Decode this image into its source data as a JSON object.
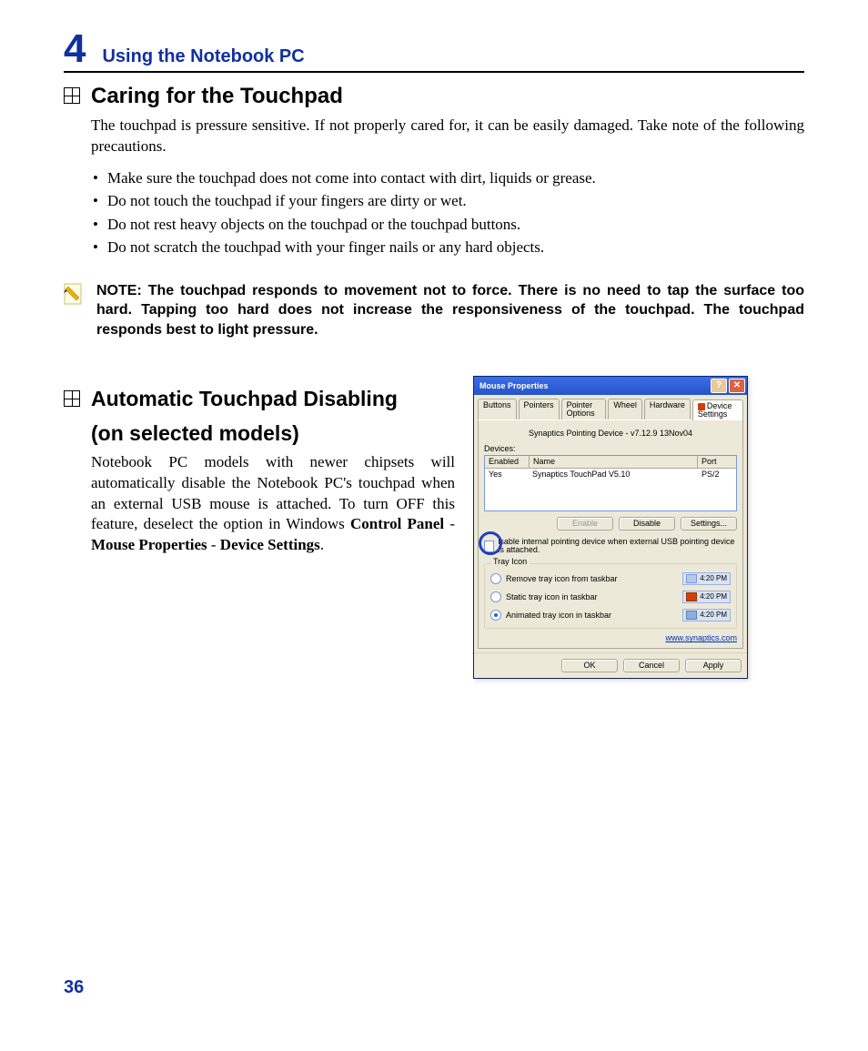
{
  "chapter": {
    "number": "4",
    "title": "Using the Notebook PC"
  },
  "sec1": {
    "title": "Caring for the Touchpad",
    "intro": "The touchpad is pressure sensitive. If not properly cared for, it can be easily damaged. Take note of the following precautions.",
    "bullets": [
      "Make sure the touchpad does not come into contact with dirt, liquids or grease.",
      "Do not touch the touchpad if your fingers are dirty or wet.",
      "Do not rest heavy objects on the touchpad or the touchpad buttons.",
      "Do not scratch the touchpad with your finger nails or any hard objects."
    ]
  },
  "note": {
    "prefix": "NOTE:  ",
    "text": "The touchpad responds to movement not to force. There is no need to tap the surface too hard. Tapping too hard does not increase the responsiveness of the touchpad. The touchpad responds best to light pressure."
  },
  "sec2": {
    "title_l1": "Automatic Touchpad Disabling",
    "title_l2": "(on selected models)",
    "body_plain": "Notebook PC models with newer chipsets will automatically disable the Notebook PC's touchpad when an external USB mouse is attached. To turn OFF this feature, deselect the option in Windows ",
    "b1": "Control Panel",
    "d1": " - ",
    "b2": "Mouse Properties",
    "d2": " - ",
    "b3": "Device Settings",
    "end": "."
  },
  "dialog": {
    "title": "Mouse Properties",
    "help": "?",
    "close": "✕",
    "tabs": {
      "t1": "Buttons",
      "t2": "Pointers",
      "t3": "Pointer Options",
      "t4": "Wheel",
      "t5": "Hardware",
      "t6": "Device Settings"
    },
    "driver": "Synaptics Pointing Device - v7.12.9 13Nov04",
    "devices_label": "Devices:",
    "cols": {
      "enabled": "Enabled",
      "name": "Name",
      "port": "Port"
    },
    "row": {
      "enabled": "Yes",
      "name": "Synaptics TouchPad V5.10",
      "port": "PS/2"
    },
    "btns": {
      "enable": "Enable",
      "disable": "Disable",
      "settings": "Settings..."
    },
    "checkbox": "isable internal pointing device when external USB pointing device is attached.",
    "tray": {
      "legend": "Tray Icon",
      "r1": "Remove tray icon from taskbar",
      "r2": "Static tray icon in taskbar",
      "r3": "Animated tray icon in taskbar",
      "time": "4:20 PM"
    },
    "link": "www.synaptics.com",
    "footer": {
      "ok": "OK",
      "cancel": "Cancel",
      "apply": "Apply"
    }
  },
  "page_number": "36"
}
